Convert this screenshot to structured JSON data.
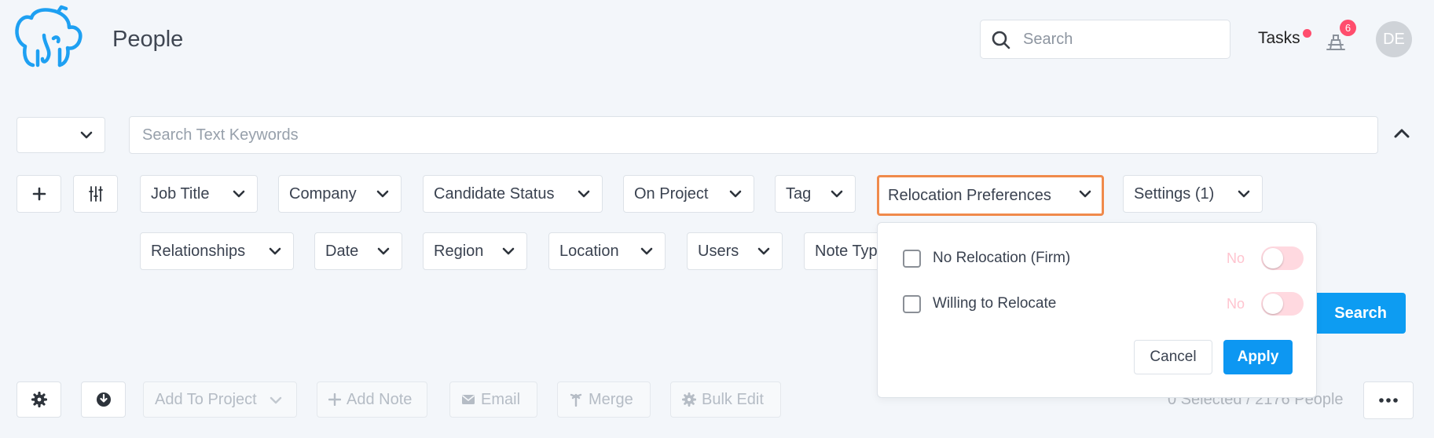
{
  "header": {
    "title": "People",
    "search_placeholder": "Search",
    "tasks_label": "Tasks",
    "notifications_count": "6",
    "avatar_initials": "DE"
  },
  "search_bar": {
    "mode_value": "",
    "keywords_placeholder": "Search Text Keywords"
  },
  "filters": {
    "row1": [
      "Job Title",
      "Company",
      "Candidate Status",
      "On Project",
      "Tag",
      "Relocation Preferences",
      "Settings (1)"
    ],
    "row2": [
      "Relationships",
      "Date",
      "Region",
      "Location",
      "Users",
      "Note Typ"
    ]
  },
  "relocation_panel": {
    "options": [
      {
        "label": "No Relocation (Firm)",
        "toggle_label": "No"
      },
      {
        "label": "Willing to Relocate",
        "toggle_label": "No"
      }
    ],
    "cancel_label": "Cancel",
    "apply_label": "Apply"
  },
  "search_button_label": "Search",
  "toolbar": {
    "add_to_project": "Add To Project",
    "add_note": "Add Note",
    "email": "Email",
    "merge": "Merge",
    "bulk_edit": "Bulk Edit",
    "selection_count": "0 Selected / 2176 People"
  },
  "colors": {
    "accent": "#0d97f2",
    "active_outline": "#f08a4b",
    "badge": "#ff4d6d",
    "logo": "#1ea0f2"
  }
}
